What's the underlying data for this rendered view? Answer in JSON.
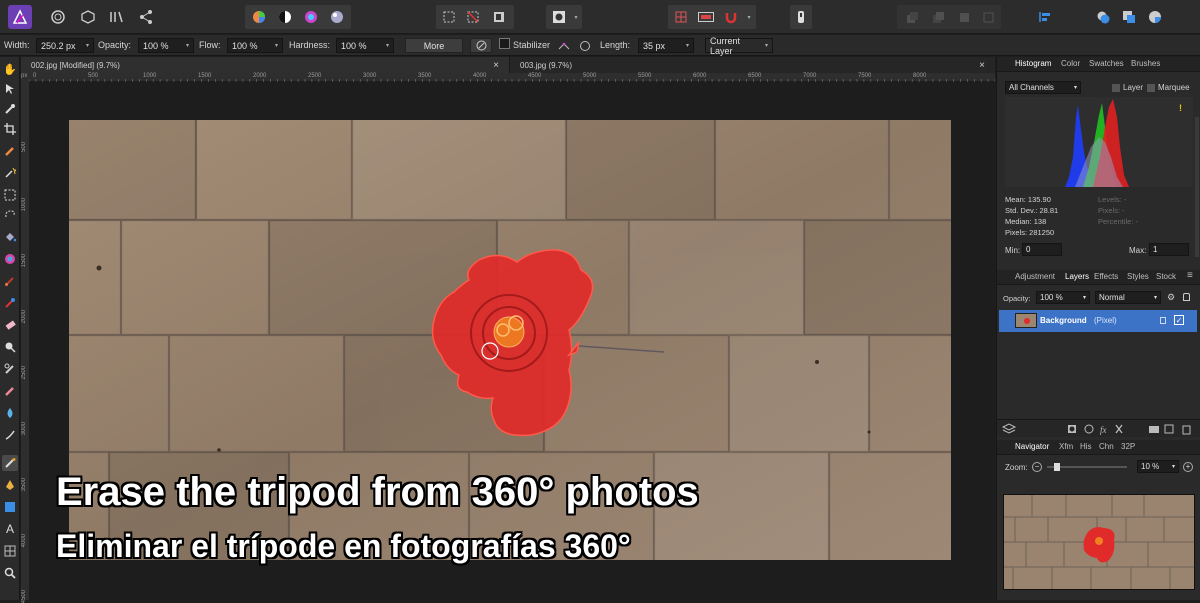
{
  "colors": {
    "accent": "#0e6fc4",
    "mask_red": "#e12a2a",
    "tile": "#9d8670"
  },
  "context_bar": {
    "width_label": "Width:",
    "width_value": "250.2 px",
    "opacity_label": "Opacity:",
    "opacity_value": "100 %",
    "flow_label": "Flow:",
    "flow_value": "100 %",
    "hardness_label": "Hardness:",
    "hardness_value": "100 %",
    "more_label": "More",
    "stabilizer_label": "Stabilizer",
    "length_label": "Length:",
    "length_value": "35 px",
    "source_value": "Current Layer"
  },
  "document_tabs": [
    {
      "label": "002.jpg [Modified] (9.7%)",
      "close": "×"
    },
    {
      "label": "003.jpg (9.7%)",
      "close": "×"
    }
  ],
  "ruler": {
    "unit": "px",
    "top_ticks": [
      "0",
      "500",
      "1000",
      "1500",
      "2000",
      "2500",
      "3000",
      "3500",
      "4000",
      "4500",
      "5000",
      "5500",
      "6000",
      "6500",
      "7000",
      "7500",
      "8000"
    ],
    "left_ticks": [
      "500",
      "1000",
      "1500",
      "2000",
      "2500",
      "3000",
      "3500",
      "4000",
      "4500"
    ]
  },
  "histogram_panel": {
    "tabs": [
      "Histogram",
      "Color",
      "Swatches",
      "Brushes"
    ],
    "channel": "All Channels",
    "layer_label": "Layer",
    "marquee_label": "Marquee",
    "stats_left": [
      "Mean: 135.90",
      "Std. Dev.: 28.81",
      "Median: 138",
      "Pixels: 281250"
    ],
    "stats_right": [
      "Levels: -",
      "Pixels: -",
      "Percentile: -"
    ],
    "min_label": "Min:",
    "min_value": "0",
    "max_label": "Max:",
    "max_value": "1",
    "warning": "!"
  },
  "layers_panel": {
    "tabs": [
      "Adjustment",
      "Layers",
      "Effects",
      "Styles",
      "Stock"
    ],
    "opacity_label": "Opacity:",
    "opacity_value": "100 %",
    "blend_mode": "Normal",
    "layer_name": "Background",
    "layer_type": "(Pixel)",
    "footer_icons": [
      "layers-stack-icon",
      "mask-icon",
      "adjustment-icon",
      "fx-icon",
      "cross-icon",
      "folder-icon",
      "grid-icon",
      "trash-icon"
    ]
  },
  "navigator_panel": {
    "tabs": [
      "Navigator",
      "Xfm",
      "His",
      "Chn",
      "32P"
    ],
    "zoom_label": "Zoom:",
    "zoom_value": "10 %",
    "zoom_level": 0.1
  },
  "captions": {
    "english": "Erase the tripod from 360° photos",
    "spanish": "Eliminar el trípode en fotografías 360°"
  }
}
